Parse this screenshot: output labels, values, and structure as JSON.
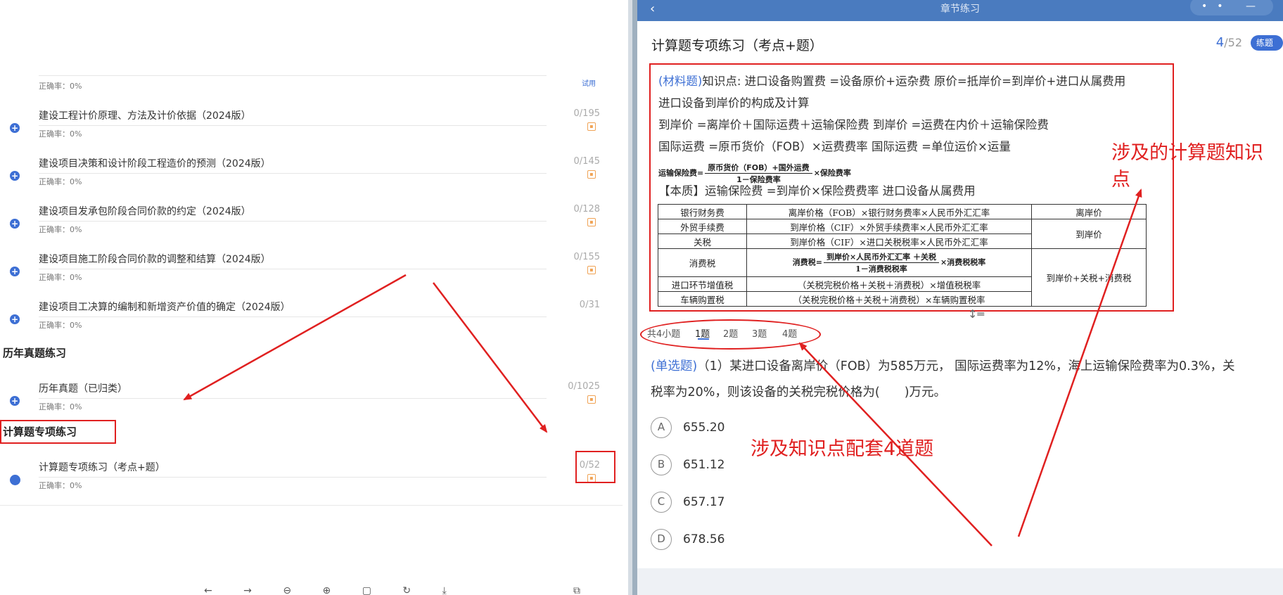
{
  "left": {
    "trial_label": "试用",
    "rate_first": "正确率：0%",
    "rows": [
      {
        "title": "建设工程计价原理、方法及计价依据（2024版）",
        "rate": "正确率：0%",
        "count": "0/195"
      },
      {
        "title": "建设项目决策和设计阶段工程造价的预测（2024版）",
        "rate": "正确率：0%",
        "count": "0/145"
      },
      {
        "title": "建设项目发承包阶段合同价款的约定（2024版）",
        "rate": "正确率：0%",
        "count": "0/128"
      },
      {
        "title": "建设项目施工阶段合同价款的调整和结算（2024版）",
        "rate": "正确率：0%",
        "count": "0/155"
      },
      {
        "title": "建设项目工决算的编制和新增资产价值的确定（2024版）",
        "rate": "正确率：0%",
        "count": "0/31"
      }
    ],
    "section_history": "历年真题练习",
    "history_row": {
      "title": "历年真题（已归类）",
      "rate": "正确率：0%",
      "count": "0/1025"
    },
    "section_calc": "计算题专项练习",
    "calc_row": {
      "title": "计算题专项练习（考点+题）",
      "rate": "正确率：0%",
      "count": "0/52"
    },
    "tools": "← → ⊖ ⊕ ▢ ↻ ⤓",
    "tools_right": "⧉ ▤"
  },
  "right": {
    "topbar_title": "章节练习",
    "back_icon": "‹",
    "controls": "•• — ▢",
    "page_title": "计算题专项练习（考点+题）",
    "page_current": "4",
    "page_total": "/52",
    "practice_badge": "练题",
    "material": {
      "tag": "(材料题)",
      "line1": "知识点: 进口设备购置费 =设备原价+运杂费 原价=抵岸价=到岸价+进口从属费用",
      "line2": "进口设备到岸价的构成及计算",
      "line3": "到岸价 =离岸价＋国际运费＋运输保险费 到岸价 =运费在内价＋运输保险费",
      "line4": "国际运费 =原币货价（FOB）×运费费率 国际运费 =单位运价×运量",
      "formula_lhs": "运输保险费=",
      "formula_num": "原币货价（FOB）+国外运费",
      "formula_den": "1－保险费率",
      "formula_tail": "×保险费率",
      "line6": "【本质】运输保险费 =到岸价×保险费费率 进口设备从属费用",
      "table": [
        [
          "银行财务费",
          "离岸价格（FOB）×银行财务费率×人民币外汇汇率",
          "离岸价"
        ],
        [
          "外贸手续费",
          "到岸价格（CIF）×外贸手续费率×人民币外汇汇率",
          "到岸价"
        ],
        [
          "关税",
          "到岸价格（CIF）×进口关税税率×人民币外汇汇率"
        ],
        [
          "消费税",
          "",
          "到岸价+关税+消费税"
        ],
        [
          "进口环节增值税",
          "（关税完税价格＋关税＋消费税）×增值税税率"
        ],
        [
          "车辆购置税",
          "（关税完税价格＋关税＋消费税）×车辆购置税率"
        ]
      ],
      "consume_lhs": "消费税=",
      "consume_num": "到岸价×人民币外汇汇率 ＋关税",
      "consume_den": "1－消费税税率",
      "consume_tail": "×消费税税率"
    },
    "subtabs": [
      "共4小题",
      "1题",
      "2题",
      "3题",
      "4题"
    ],
    "question": {
      "tag": "(单选题)",
      "line1": "（1）某进口设备离岸价（FOB）为585万元， 国际运费率为12%，海上运输保险费率为0.3%，关",
      "line2": "税率为20%，则该设备的关税完税价格为(　　)万元。"
    },
    "options": [
      {
        "letter": "A",
        "value": "655.20"
      },
      {
        "letter": "B",
        "value": "651.12"
      },
      {
        "letter": "C",
        "value": "657.17"
      },
      {
        "letter": "D",
        "value": "678.56"
      }
    ]
  },
  "annotations": {
    "calc_points_line1": "涉及的计算题知识",
    "calc_points_line2": "点",
    "four_questions": "涉及知识点配套4道题"
  },
  "colors": {
    "accent": "#3d6fd4",
    "annotation_red": "#e02020",
    "topbar": "#4a7bbf"
  }
}
